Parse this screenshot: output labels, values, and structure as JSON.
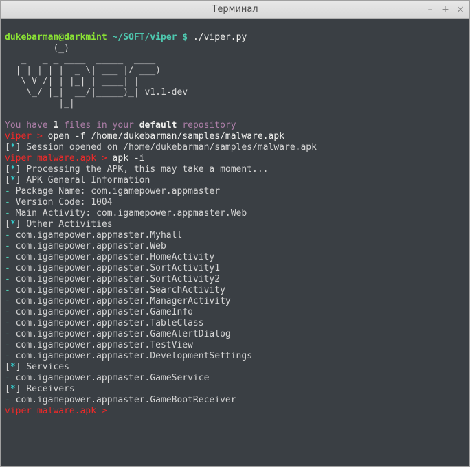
{
  "window": {
    "title": "Терминал"
  },
  "prompt1": {
    "userhost": "dukebarman@darkmint",
    "path": "~/SOFT/viper",
    "sep": "$",
    "cmd": "./viper.py"
  },
  "ascii": {
    "l1": "         (_)",
    "l2": "   _   _ _ ____  _____  ____",
    "l3": "  | | | | |  _ \\| ___ |/ ___)",
    "l4": "   \\ V /| | |_| | ____| |",
    "l5": "    \\_/ |_|  __/|_____)_| v1.1-dev",
    "l6": "          |_|"
  },
  "msg": {
    "pre": "You have ",
    "count": "1",
    "mid": " files in your ",
    "def": "default",
    "post": " repository"
  },
  "p2": {
    "prompt": "viper >",
    "cmd": " open -f /home/dukebarman/samples/malware.apk"
  },
  "session": "Session opened on /home/dukebarman/samples/malware.apk",
  "p3": {
    "a": "viper",
    "b": " malware.apk >",
    "cmd": " apk -i"
  },
  "processing": "Processing the APK, this may take a moment...",
  "hdr_general": "APK General Information",
  "pkg": " Package Name: com.igamepower.appmaster",
  "ver": " Version Code: 1004",
  "main": " Main Activity: com.igamepower.appmaster.Web",
  "hdr_other": "Other Activities",
  "acts": [
    " com.igamepower.appmaster.Myhall",
    " com.igamepower.appmaster.Web",
    " com.igamepower.appmaster.HomeActivity",
    " com.igamepower.appmaster.SortActivity1",
    " com.igamepower.appmaster.SortActivity2",
    " com.igamepower.appmaster.SearchActivity",
    " com.igamepower.appmaster.ManagerActivity",
    " com.igamepower.appmaster.GameInfo",
    " com.igamepower.appmaster.TableClass",
    " com.igamepower.appmaster.GameAlertDialog",
    " com.igamepower.appmaster.TestView",
    " com.igamepower.appmaster.DevelopmentSettings"
  ],
  "hdr_services": "Services",
  "svc": " com.igamepower.appmaster.GameService",
  "hdr_receivers": "Receivers",
  "rcv": " com.igamepower.appmaster.GameBootReceiver",
  "p4": {
    "a": "viper",
    "b": " malware.apk > "
  }
}
